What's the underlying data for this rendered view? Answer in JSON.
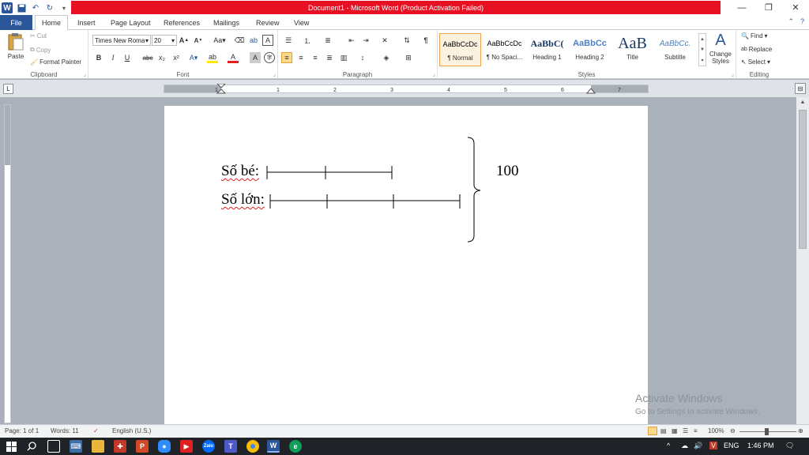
{
  "title_bar": {
    "title": "Document1 - Microsoft Word (Product Activation Failed)",
    "minimize": "—",
    "restore": "❐",
    "close": "✕"
  },
  "tabs": [
    "File",
    "Home",
    "Insert",
    "Page Layout",
    "References",
    "Mailings",
    "Review",
    "View"
  ],
  "active_tab": "Home",
  "ribbon": {
    "clipboard": {
      "paste": "Paste",
      "cut": "Cut",
      "copy": "Copy",
      "format_painter": "Format Painter",
      "label": "Clipboard"
    },
    "font": {
      "name": "Times New Roma",
      "size": "20",
      "label": "Font",
      "bold": "B",
      "italic": "I",
      "underline": "U",
      "strike": "abc",
      "subscript": "x₂",
      "superscript": "x²"
    },
    "paragraph": {
      "label": "Paragraph",
      "show_marks": "¶"
    },
    "styles": {
      "label": "Styles",
      "items": [
        {
          "sample": "AaBbCcDc",
          "name": "¶ Normal"
        },
        {
          "sample": "AaBbCcDc",
          "name": "¶ No Spaci..."
        },
        {
          "sample": "AaBbC(",
          "name": "Heading 1"
        },
        {
          "sample": "AaBbCc",
          "name": "Heading 2"
        },
        {
          "sample": "AaB",
          "name": "Title"
        },
        {
          "sample": "AaBbCc.",
          "name": "Subtitle"
        }
      ],
      "change_styles": "Change Styles"
    },
    "editing": {
      "label": "Editing",
      "find": "Find",
      "replace": "Replace",
      "select": "Select"
    }
  },
  "ruler": {
    "numbers": [
      "1",
      "1",
      "2",
      "3",
      "4",
      "5",
      "6",
      "7"
    ]
  },
  "document": {
    "line1_label": "Số bé:",
    "line2_label": "Số lớn:",
    "total": "100"
  },
  "watermark": {
    "line1": "Activate Windows",
    "line2": "Go to Settings to activate Windows."
  },
  "status_bar": {
    "page": "Page: 1 of 1",
    "words": "Words: 11",
    "language": "English (U.S.)",
    "zoom": "100%"
  },
  "taskbar": {
    "lang": "ENG",
    "time": "1:46 PM"
  }
}
